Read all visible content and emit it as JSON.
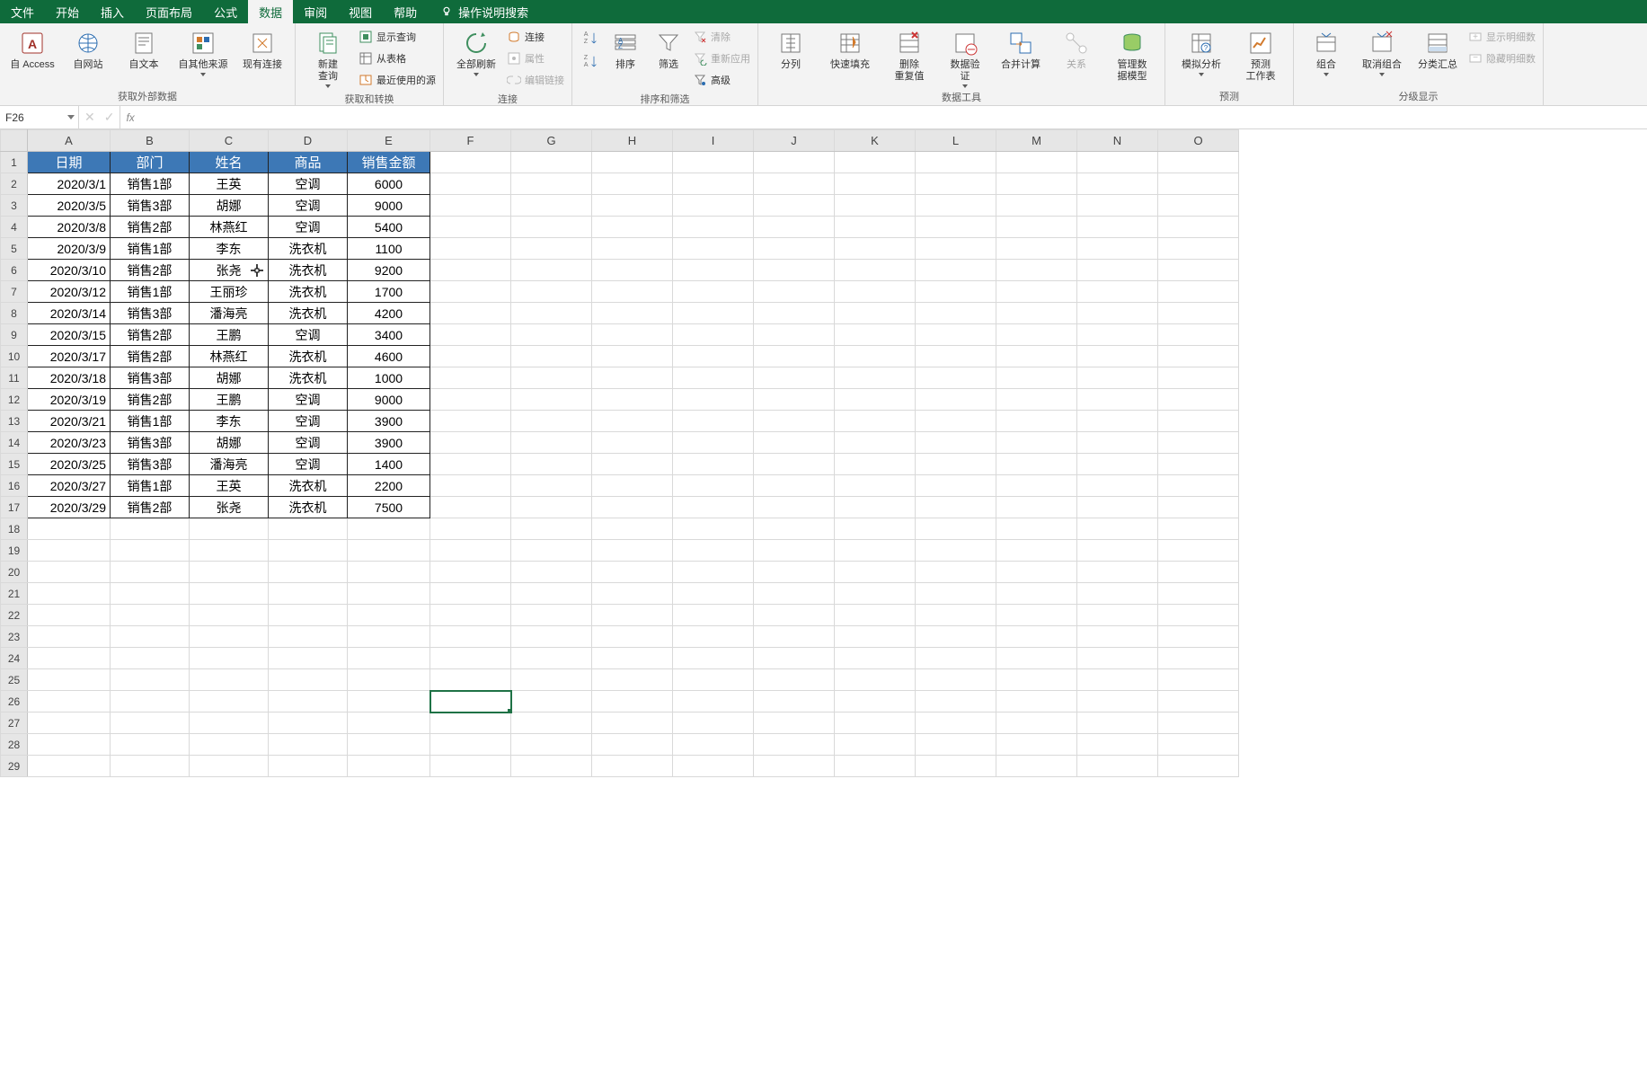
{
  "menu": {
    "items": [
      "文件",
      "开始",
      "插入",
      "页面布局",
      "公式",
      "数据",
      "审阅",
      "视图",
      "帮助"
    ],
    "active_index": 5,
    "tell_me": "操作说明搜索"
  },
  "ribbon": {
    "groups": [
      {
        "name": "获取外部数据",
        "big": [
          {
            "id": "from-access",
            "label": "自 Access"
          },
          {
            "id": "from-web",
            "label": "自网站"
          },
          {
            "id": "from-text",
            "label": "自文本"
          },
          {
            "id": "from-other",
            "label": "自其他来源",
            "caret": true
          },
          {
            "id": "existing-conn",
            "label": "现有连接"
          }
        ]
      },
      {
        "name": "获取和转换",
        "big": [
          {
            "id": "new-query",
            "label": "新建\n查询",
            "caret": true
          }
        ],
        "small": [
          {
            "id": "show-queries",
            "label": "显示查询"
          },
          {
            "id": "from-table",
            "label": "从表格"
          },
          {
            "id": "recent-sources",
            "label": "最近使用的源"
          }
        ]
      },
      {
        "name": "连接",
        "big": [
          {
            "id": "refresh-all",
            "label": "全部刷新",
            "caret": true
          }
        ],
        "small": [
          {
            "id": "connections",
            "label": "连接"
          },
          {
            "id": "properties",
            "label": "属性",
            "disabled": true
          },
          {
            "id": "edit-links",
            "label": "编辑链接",
            "disabled": true
          }
        ]
      },
      {
        "name": "排序和筛选",
        "big": [
          {
            "id": "sort-az",
            "label": ""
          },
          {
            "id": "sort-za",
            "label": ""
          },
          {
            "id": "sort",
            "label": "排序"
          },
          {
            "id": "filter",
            "label": "筛选"
          }
        ],
        "small": [
          {
            "id": "clear",
            "label": "清除",
            "disabled": true
          },
          {
            "id": "reapply",
            "label": "重新应用",
            "disabled": true
          },
          {
            "id": "advanced",
            "label": "高级"
          }
        ]
      },
      {
        "name": "数据工具",
        "big": [
          {
            "id": "text-to-columns",
            "label": "分列"
          },
          {
            "id": "flash-fill",
            "label": "快速填充"
          },
          {
            "id": "remove-duplicates",
            "label": "删除\n重复值"
          },
          {
            "id": "data-validation",
            "label": "数据验\n证",
            "caret": true
          },
          {
            "id": "consolidate",
            "label": "合并计算"
          },
          {
            "id": "relationships",
            "label": "关系",
            "disabled": true
          },
          {
            "id": "manage-data-model",
            "label": "管理数\n据模型"
          }
        ]
      },
      {
        "name": "预测",
        "big": [
          {
            "id": "what-if",
            "label": "模拟分析",
            "caret": true
          },
          {
            "id": "forecast-sheet",
            "label": "预测\n工作表"
          }
        ]
      },
      {
        "name": "分级显示",
        "big": [
          {
            "id": "group",
            "label": "组合",
            "caret": true
          },
          {
            "id": "ungroup",
            "label": "取消组合",
            "caret": true
          },
          {
            "id": "subtotal",
            "label": "分类汇总"
          }
        ],
        "small": [
          {
            "id": "show-detail",
            "label": "显示明细数",
            "disabled": true
          },
          {
            "id": "hide-detail",
            "label": "隐藏明细数",
            "disabled": true
          }
        ]
      }
    ]
  },
  "namebox": "F26",
  "formula": "",
  "columns": [
    "A",
    "B",
    "C",
    "D",
    "E",
    "F",
    "G",
    "H",
    "I",
    "J",
    "K",
    "L",
    "M",
    "N",
    "O"
  ],
  "row_count": 29,
  "header_row": [
    "日期",
    "部门",
    "姓名",
    "商品",
    "销售金额"
  ],
  "data_rows": [
    [
      "2020/3/1",
      "销售1部",
      "王英",
      "空调",
      "6000"
    ],
    [
      "2020/3/5",
      "销售3部",
      "胡娜",
      "空调",
      "9000"
    ],
    [
      "2020/3/8",
      "销售2部",
      "林燕红",
      "空调",
      "5400"
    ],
    [
      "2020/3/9",
      "销售1部",
      "李东",
      "洗衣机",
      "1100"
    ],
    [
      "2020/3/10",
      "销售2部",
      "张尧",
      "洗衣机",
      "9200"
    ],
    [
      "2020/3/12",
      "销售1部",
      "王丽珍",
      "洗衣机",
      "1700"
    ],
    [
      "2020/3/14",
      "销售3部",
      "潘海亮",
      "洗衣机",
      "4200"
    ],
    [
      "2020/3/15",
      "销售2部",
      "王鹏",
      "空调",
      "3400"
    ],
    [
      "2020/3/17",
      "销售2部",
      "林燕红",
      "洗衣机",
      "4600"
    ],
    [
      "2020/3/18",
      "销售3部",
      "胡娜",
      "洗衣机",
      "1000"
    ],
    [
      "2020/3/19",
      "销售2部",
      "王鹏",
      "空调",
      "9000"
    ],
    [
      "2020/3/21",
      "销售1部",
      "李东",
      "空调",
      "3900"
    ],
    [
      "2020/3/23",
      "销售3部",
      "胡娜",
      "空调",
      "3900"
    ],
    [
      "2020/3/25",
      "销售3部",
      "潘海亮",
      "空调",
      "1400"
    ],
    [
      "2020/3/27",
      "销售1部",
      "王英",
      "洗衣机",
      "2200"
    ],
    [
      "2020/3/29",
      "销售2部",
      "张尧",
      "洗衣机",
      "7500"
    ]
  ],
  "selected_cell": {
    "col": "F",
    "row": 26
  },
  "cursor_position": {
    "col": "C",
    "row": 6
  }
}
